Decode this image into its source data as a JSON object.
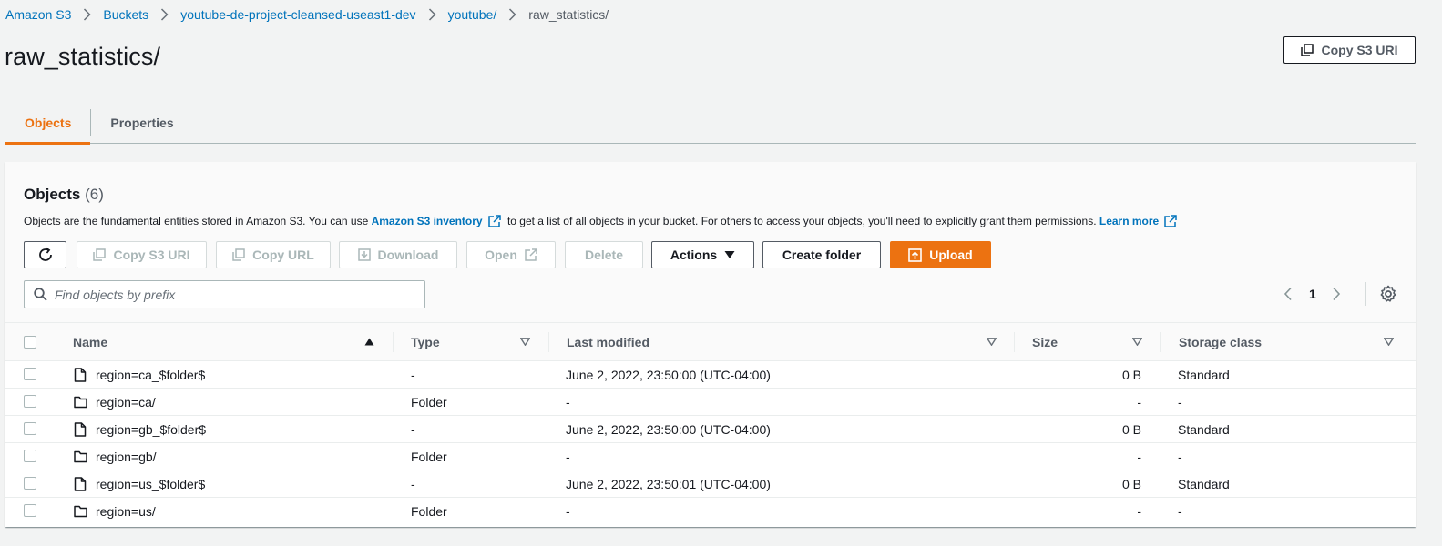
{
  "breadcrumb": {
    "items": [
      "Amazon S3",
      "Buckets",
      "youtube-de-project-cleansed-useast1-dev",
      "youtube/"
    ],
    "current": "raw_statistics/"
  },
  "header": {
    "title": "raw_statistics/",
    "copy_uri_label": "Copy S3 URI"
  },
  "tabs": [
    {
      "label": "Objects",
      "active": true
    },
    {
      "label": "Properties",
      "active": false
    }
  ],
  "objects_panel": {
    "title": "Objects",
    "count": "(6)",
    "description_prefix": "Objects are the fundamental entities stored in Amazon S3. You can use ",
    "inventory_link": "Amazon S3 inventory",
    "description_middle": " to get a list of all objects in your bucket. For others to access your objects, you'll need to explicitly grant them permissions. ",
    "learn_more_link": "Learn more",
    "toolbar": {
      "copy_s3_uri": "Copy S3 URI",
      "copy_url": "Copy URL",
      "download": "Download",
      "open": "Open",
      "delete": "Delete",
      "actions": "Actions",
      "create_folder": "Create folder",
      "upload": "Upload"
    },
    "search": {
      "placeholder": "Find objects by prefix",
      "value": ""
    },
    "pagination": {
      "current_page": "1"
    }
  },
  "table": {
    "columns": [
      "Name",
      "Type",
      "Last modified",
      "Size",
      "Storage class"
    ],
    "sorted_by": "Name",
    "rows": [
      {
        "icon": "file-icon",
        "name": "region=ca_$folder$",
        "type": "-",
        "last_modified": "June 2, 2022, 23:50:00 (UTC-04:00)",
        "size": "0 B",
        "storage_class": "Standard"
      },
      {
        "icon": "folder-icon",
        "name": "region=ca/",
        "type": "Folder",
        "last_modified": "-",
        "size": "-",
        "storage_class": "-"
      },
      {
        "icon": "file-icon",
        "name": "region=gb_$folder$",
        "type": "-",
        "last_modified": "June 2, 2022, 23:50:00 (UTC-04:00)",
        "size": "0 B",
        "storage_class": "Standard"
      },
      {
        "icon": "folder-icon",
        "name": "region=gb/",
        "type": "Folder",
        "last_modified": "-",
        "size": "-",
        "storage_class": "-"
      },
      {
        "icon": "file-icon",
        "name": "region=us_$folder$",
        "type": "-",
        "last_modified": "June 2, 2022, 23:50:01 (UTC-04:00)",
        "size": "0 B",
        "storage_class": "Standard"
      },
      {
        "icon": "folder-icon",
        "name": "region=us/",
        "type": "Folder",
        "last_modified": "-",
        "size": "-",
        "storage_class": "-"
      }
    ]
  },
  "colors": {
    "accent": "#ec7211",
    "link": "#0073bb",
    "text": "#16191f",
    "muted": "#545b64",
    "background": "#f2f3f3"
  }
}
